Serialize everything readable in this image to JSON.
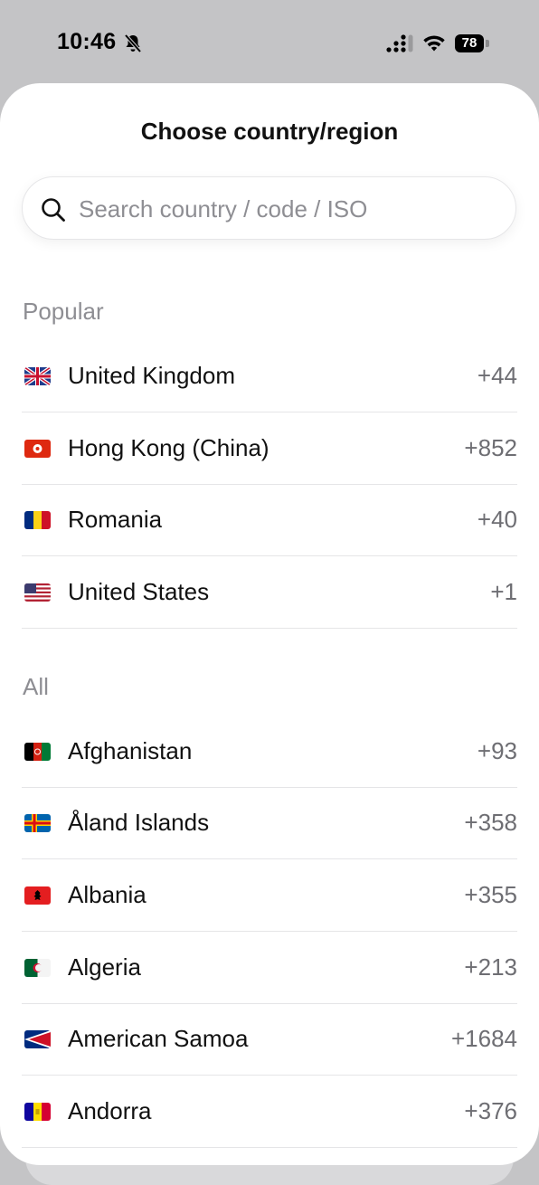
{
  "status_bar": {
    "time": "10:46",
    "battery": "78"
  },
  "sheet": {
    "title": "Choose country/region"
  },
  "search": {
    "placeholder": "Search country / code / ISO",
    "value": ""
  },
  "sections": {
    "popular": "Popular",
    "all": "All"
  },
  "popular": [
    {
      "name": "United Kingdom",
      "code": "+44",
      "flag": "gb"
    },
    {
      "name": "Hong Kong (China)",
      "code": "+852",
      "flag": "hk"
    },
    {
      "name": "Romania",
      "code": "+40",
      "flag": "ro"
    },
    {
      "name": "United States",
      "code": "+1",
      "flag": "us"
    }
  ],
  "all": [
    {
      "name": "Afghanistan",
      "code": "+93",
      "flag": "af"
    },
    {
      "name": "Åland Islands",
      "code": "+358",
      "flag": "ax"
    },
    {
      "name": "Albania",
      "code": "+355",
      "flag": "al"
    },
    {
      "name": "Algeria",
      "code": "+213",
      "flag": "dz"
    },
    {
      "name": "American Samoa",
      "code": "+1684",
      "flag": "as"
    },
    {
      "name": "Andorra",
      "code": "+376",
      "flag": "ad"
    }
  ]
}
